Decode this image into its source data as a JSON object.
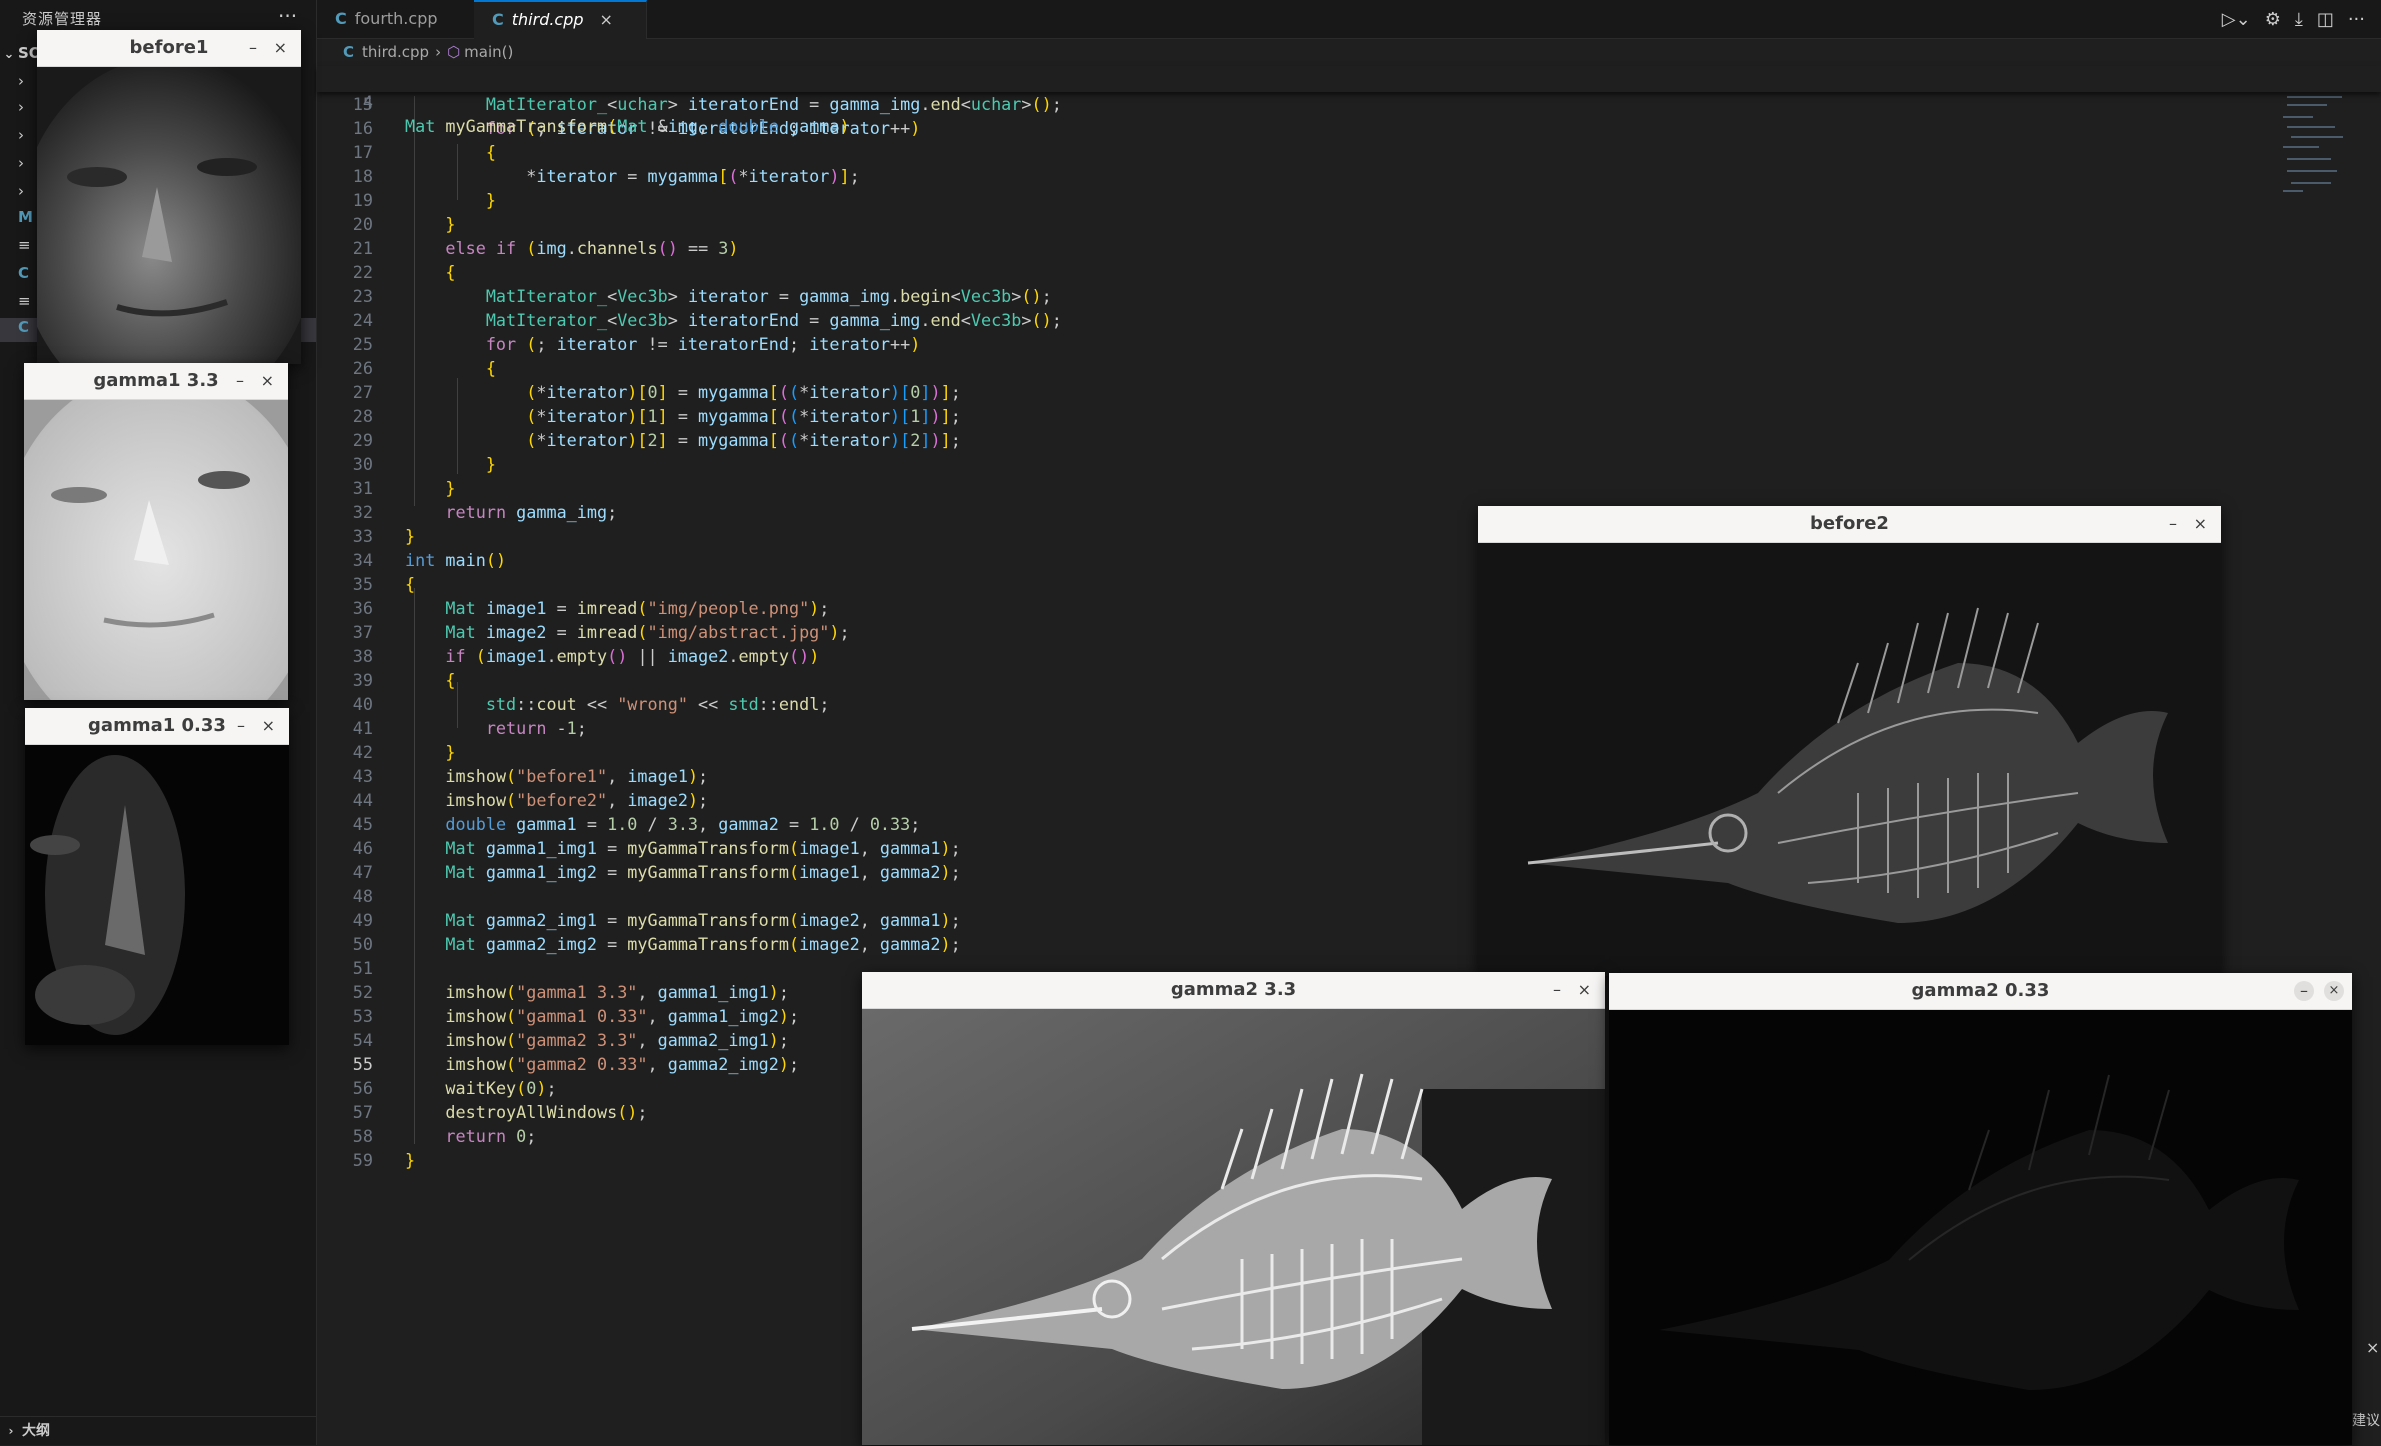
{
  "sidebar": {
    "title": "资源管理器",
    "more": "···",
    "folder": "SO",
    "outline": "大纲"
  },
  "tabs": [
    {
      "label": "fourth.cpp",
      "icon": "C++"
    },
    {
      "label": "third.cpp",
      "icon": "C++"
    }
  ],
  "breadcrumb": {
    "file": "third.cpp",
    "symbol": "main()"
  },
  "code": {
    "sticky_number": "4",
    "lines": [
      {
        "n": "15",
        "t": "        MatIterator_<uchar> iteratorEnd = gamma_img.end<uchar>();"
      },
      {
        "n": "16",
        "t": "        for (; iterator != iteratorEnd; iterator++)"
      },
      {
        "n": "17",
        "t": "        {"
      },
      {
        "n": "18",
        "t": "            *iterator = mygamma[(*iterator)];"
      },
      {
        "n": "19",
        "t": "        }"
      },
      {
        "n": "20",
        "t": "    }"
      },
      {
        "n": "21",
        "t": "    else if (img.channels() == 3)"
      },
      {
        "n": "22",
        "t": "    {"
      },
      {
        "n": "23",
        "t": "        MatIterator_<Vec3b> iterator = gamma_img.begin<Vec3b>();"
      },
      {
        "n": "24",
        "t": "        MatIterator_<Vec3b> iteratorEnd = gamma_img.end<Vec3b>();"
      },
      {
        "n": "25",
        "t": "        for (; iterator != iteratorEnd; iterator++)"
      },
      {
        "n": "26",
        "t": "        {"
      },
      {
        "n": "27",
        "t": "            (*iterator)[0] = mygamma[((*iterator)[0])];"
      },
      {
        "n": "28",
        "t": "            (*iterator)[1] = mygamma[((*iterator)[1])];"
      },
      {
        "n": "29",
        "t": "            (*iterator)[2] = mygamma[((*iterator)[2])];"
      },
      {
        "n": "30",
        "t": "        }"
      },
      {
        "n": "31",
        "t": "    }"
      },
      {
        "n": "32",
        "t": "    return gamma_img;"
      },
      {
        "n": "33",
        "t": "}"
      },
      {
        "n": "34",
        "t": "int main()"
      },
      {
        "n": "35",
        "t": "{"
      },
      {
        "n": "36",
        "t": "    Mat image1 = imread(\"img/people.png\");"
      },
      {
        "n": "37",
        "t": "    Mat image2 = imread(\"img/abstract.jpg\");"
      },
      {
        "n": "38",
        "t": "    if (image1.empty() || image2.empty())"
      },
      {
        "n": "39",
        "t": "    {"
      },
      {
        "n": "40",
        "t": "        std::cout << \"wrong\" << std::endl;"
      },
      {
        "n": "41",
        "t": "        return -1;"
      },
      {
        "n": "42",
        "t": "    }"
      },
      {
        "n": "43",
        "t": "    imshow(\"before1\", image1);"
      },
      {
        "n": "44",
        "t": "    imshow(\"before2\", image2);"
      },
      {
        "n": "45",
        "t": "    double gamma1 = 1.0 / 3.3, gamma2 = 1.0 / 0.33;"
      },
      {
        "n": "46",
        "t": "    Mat gamma1_img1 = myGammaTransform(image1, gamma1);"
      },
      {
        "n": "47",
        "t": "    Mat gamma1_img2 = myGammaTransform(image1, gamma2);"
      },
      {
        "n": "48",
        "t": ""
      },
      {
        "n": "49",
        "t": "    Mat gamma2_img1 = myGammaTransform(image2, gamma1);"
      },
      {
        "n": "50",
        "t": "    Mat gamma2_img2 = myGammaTransform(image2, gamma2);"
      },
      {
        "n": "51",
        "t": ""
      },
      {
        "n": "52",
        "t": "    imshow(\"gamma1 3.3\", gamma1_img1);"
      },
      {
        "n": "53",
        "t": "    imshow(\"gamma1 0.33\", gamma1_img2);"
      },
      {
        "n": "54",
        "t": "    imshow(\"gamma2 3.3\", gamma2_img1);"
      },
      {
        "n": "55",
        "t": "    imshow(\"gamma2 0.33\", gamma2_img2);"
      },
      {
        "n": "56",
        "t": "    waitKey(0);"
      },
      {
        "n": "57",
        "t": "    destroyAllWindows();"
      },
      {
        "n": "58",
        "t": "    return 0;"
      },
      {
        "n": "59",
        "t": "}"
      }
    ],
    "current_line": "55"
  },
  "windows": {
    "before1": {
      "title": "before1",
      "min": "–",
      "close": "×"
    },
    "gamma1_33": {
      "title": "gamma1 3.3",
      "min": "–",
      "close": "×"
    },
    "gamma1_033": {
      "title": "gamma1 0.33",
      "min": "–",
      "close": "×"
    },
    "before2": {
      "title": "before2",
      "min": "–",
      "close": "×"
    },
    "gamma2_33": {
      "title": "gamma2 3.3",
      "min": "–",
      "close": "×"
    },
    "gamma2_033": {
      "title": "gamma2 0.33",
      "min": "–",
      "close": "×"
    }
  },
  "edge": {
    "close": "×",
    "text": "建议"
  }
}
